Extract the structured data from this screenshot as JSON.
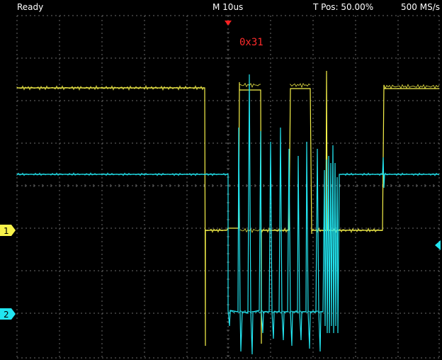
{
  "status": {
    "state": "Ready",
    "timebase": "M 10us",
    "trigger_position": "T Pos: 50.00%",
    "sample_rate": "500 MS/s"
  },
  "annotation": {
    "text": "0x31"
  },
  "channels": [
    {
      "id": "1",
      "color": "#f7f24a"
    },
    {
      "id": "2",
      "color": "#22e5f0"
    }
  ],
  "icons": {
    "trigger_marker": "down-triangle-red",
    "ch1_marker": "right-pointing-badge-yellow",
    "ch2_marker": "right-pointing-badge-cyan",
    "trigger_level_marker": "left-triangle-cyan"
  }
}
